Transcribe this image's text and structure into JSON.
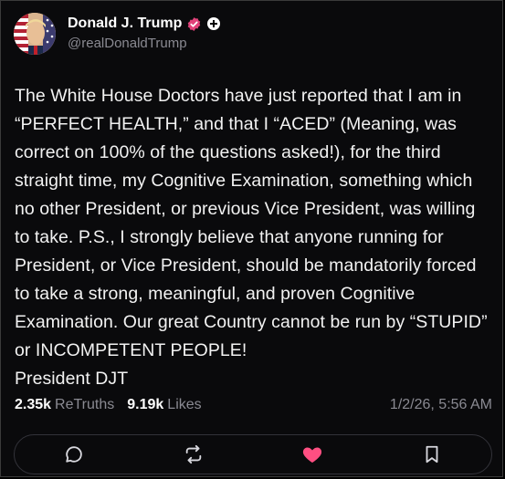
{
  "post": {
    "author": {
      "display_name": "Donald J. Trump",
      "handle": "@realDonaldTrump",
      "avatar_icon": "avatar-flag-portrait",
      "verified_color": "#e0427a"
    },
    "text": [
      "The White House Doctors have just reported that I am in “PERFECT HEALTH,” and that I “ACED” (Meaning, was correct on 100% of the questions asked!), for the third straight time, my Cognitive Examination, something which no other President, or previous Vice President, was willing to take. P.S., I strongly believe that anyone running for President, or Vice President, should be mandatorily forced to take a strong, meaningful, and proven Cognitive Examination. Our great Country cannot be run by “STUPID” or INCOMPETENT PEOPLE!",
      "President DJT"
    ],
    "stats": {
      "retruths_count": "2.35k",
      "retruths_label": "ReTruths",
      "likes_count": "9.19k",
      "likes_label": "Likes"
    },
    "timestamp": "1/2/26, 5:56 AM"
  },
  "actions": [
    {
      "icon": "comment-icon"
    },
    {
      "icon": "retruth-icon"
    },
    {
      "icon": "heart-icon",
      "active_color": "#ff4f82"
    },
    {
      "icon": "bookmark-icon"
    }
  ]
}
